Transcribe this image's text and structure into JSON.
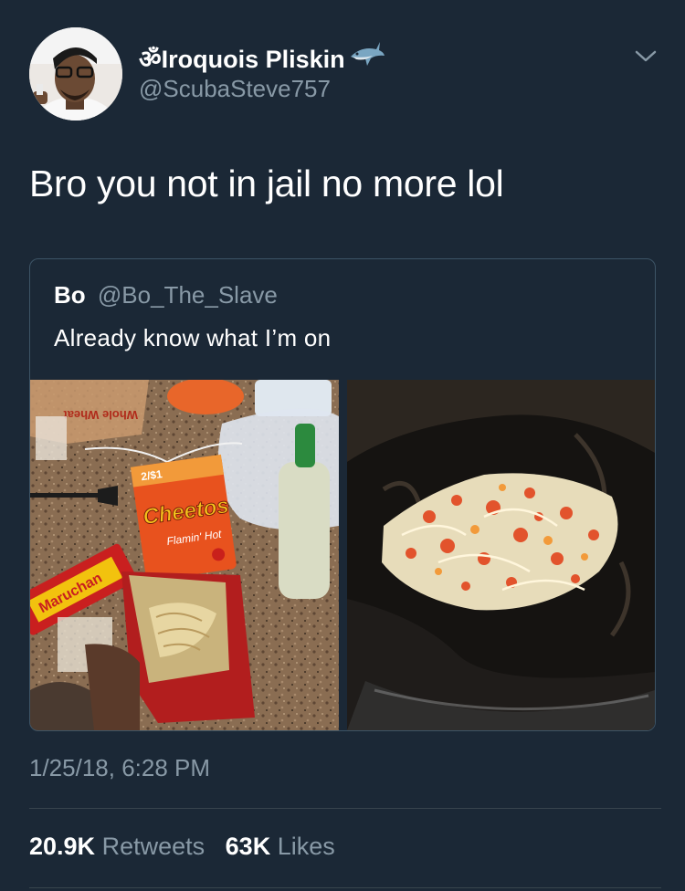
{
  "tweet": {
    "display_name": "ॐIroquois Pliskin",
    "handle": "@ScubaSteve757",
    "text": "Bro you not in jail no more lol",
    "timestamp": "1/25/18, 6:28 PM",
    "retweets_count": "20.9K",
    "retweets_label": "Retweets",
    "likes_count": "63K",
    "likes_label": "Likes"
  },
  "quoted_tweet": {
    "name": "Bo",
    "handle": "@Bo_The_Slave",
    "text": "Already know what I’m on",
    "photos": [
      {
        "name": "snacks-on-counter-photo",
        "labels": {
          "brand": "Cheetos",
          "flavor": "Flamin' Hot",
          "price": "2/$1",
          "noodles": "Maruchan"
        }
      },
      {
        "name": "noodles-in-bag-photo"
      }
    ]
  },
  "icons": {
    "caret": "chevron-down-icon",
    "emoji": "shark-icon"
  },
  "colors": {
    "background": "#1b2836",
    "secondary_text": "#8899a6",
    "border": "#3d5466"
  }
}
